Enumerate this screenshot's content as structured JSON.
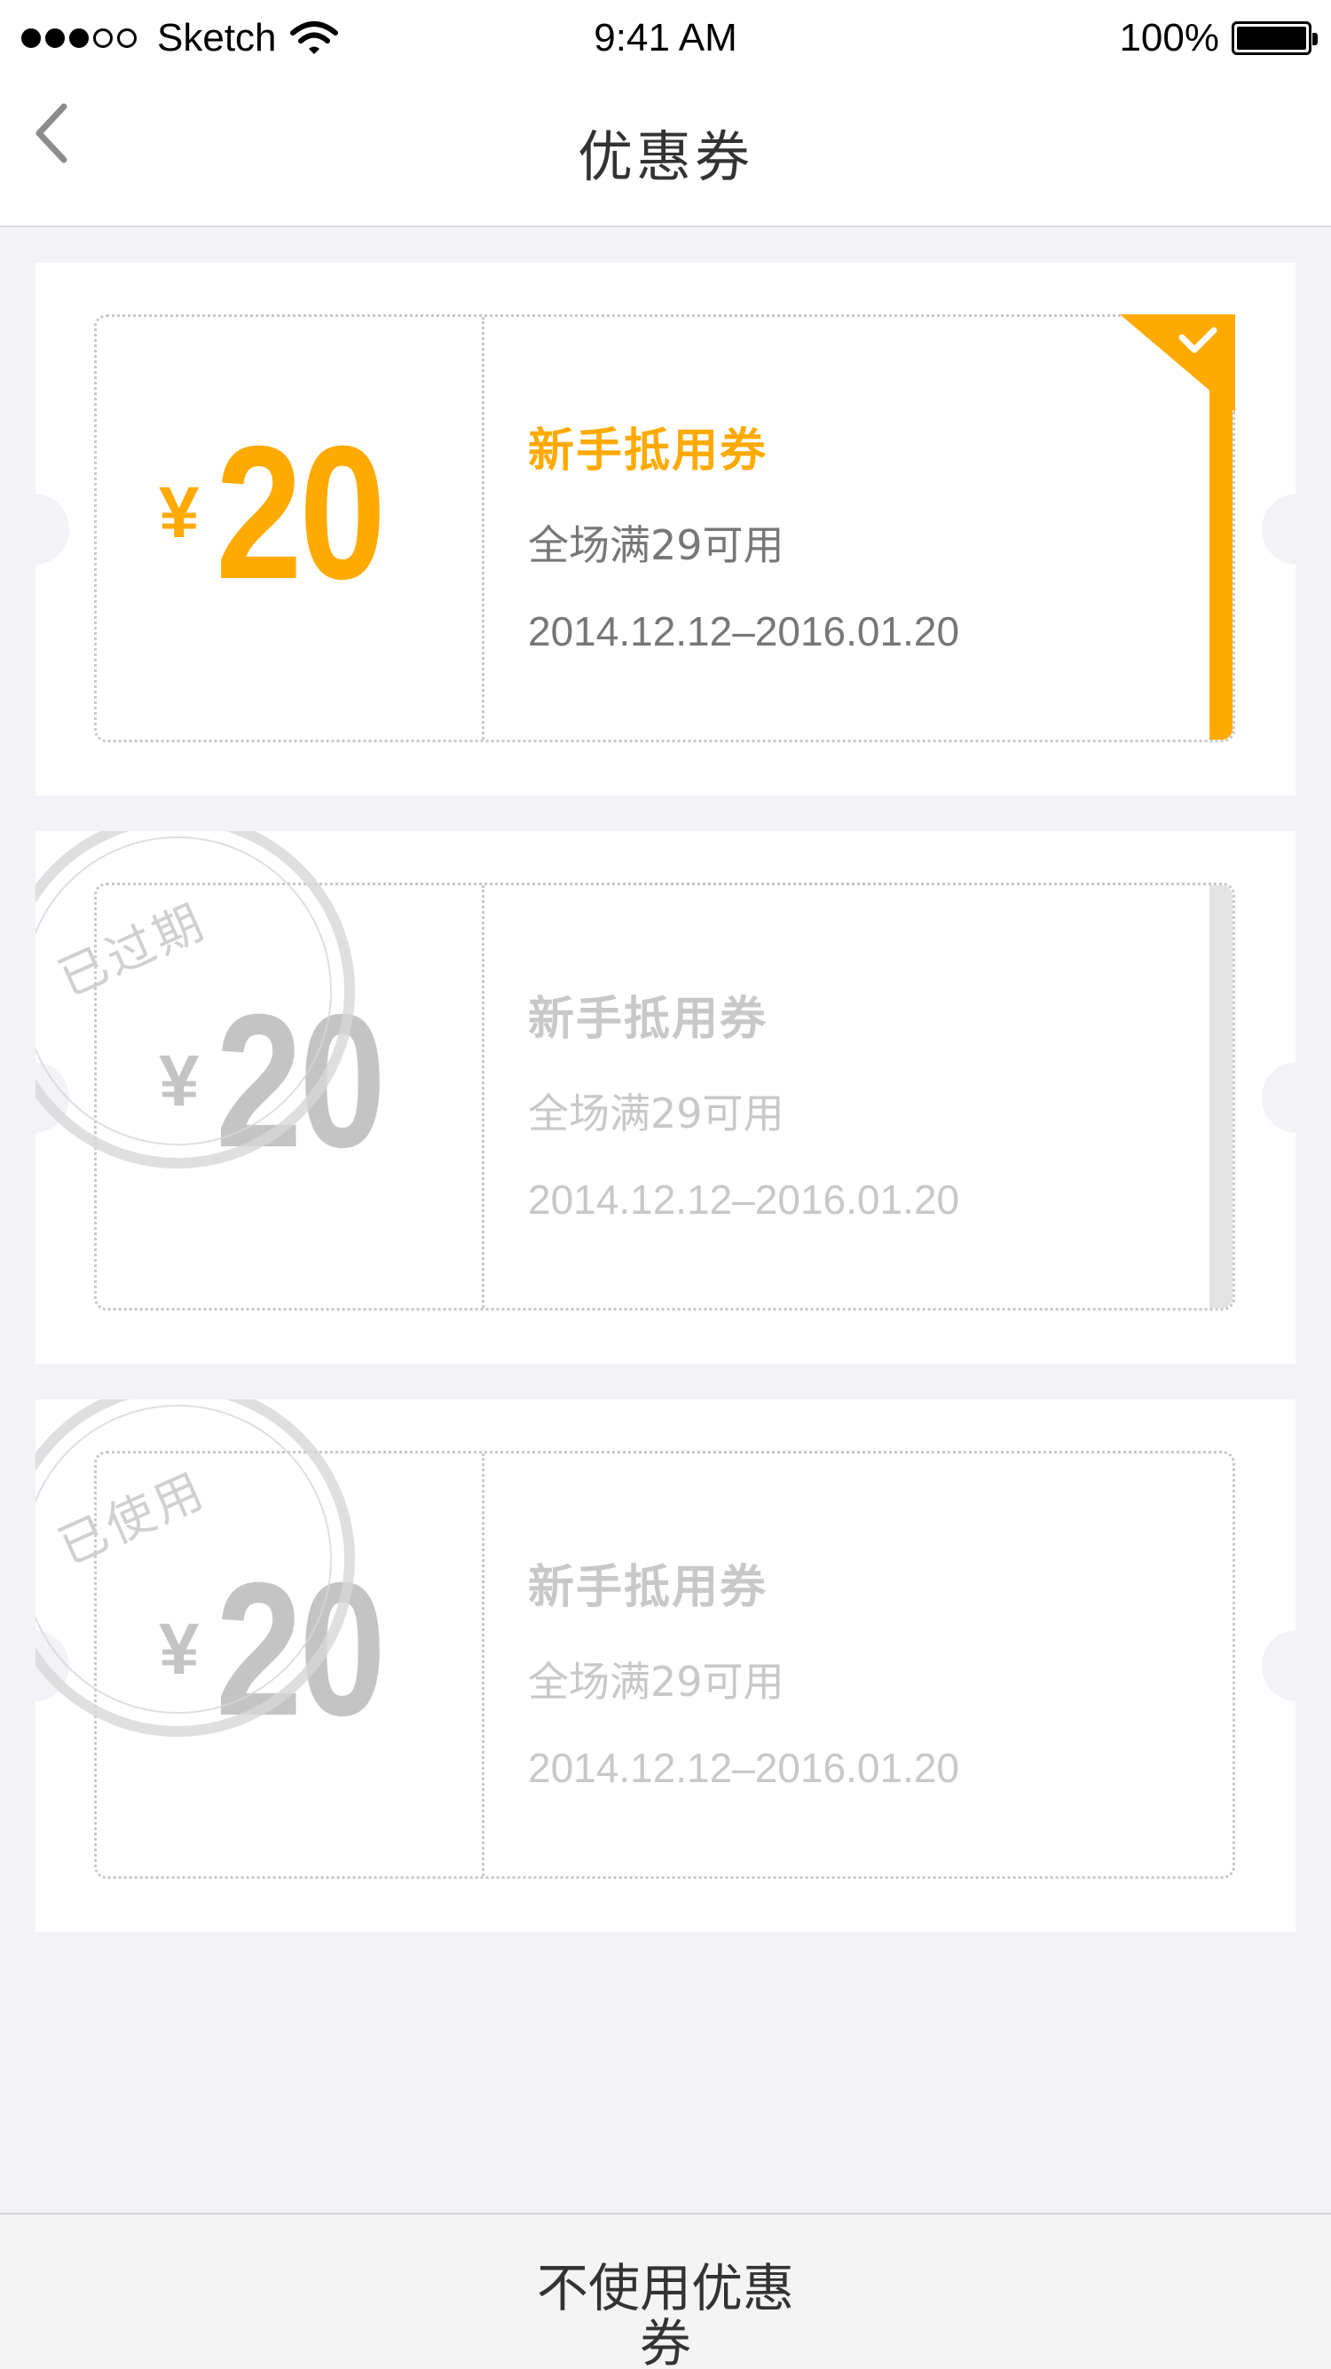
{
  "status_bar": {
    "carrier": "Sketch",
    "time": "9:41 AM",
    "battery": "100%",
    "battery_level": 1.0,
    "signal_bars_filled": 3,
    "signal_bars_total": 5
  },
  "nav": {
    "title": "优惠券",
    "back_icon": "chevron-left-icon"
  },
  "coupons": [
    {
      "currency": "¥",
      "amount": "20",
      "name": "新手抵用券",
      "condition": "全场满29可用",
      "validity": "2014.12.12–2016.01.20",
      "state": "selected",
      "stamp": ""
    },
    {
      "currency": "¥",
      "amount": "20",
      "name": "新手抵用券",
      "condition": "全场满29可用",
      "validity": "2014.12.12–2016.01.20",
      "state": "expired",
      "stamp": "已过期"
    },
    {
      "currency": "¥",
      "amount": "20",
      "name": "新手抵用券",
      "condition": "全场满29可用",
      "validity": "2014.12.12–2016.01.20",
      "state": "used",
      "stamp": "已使用"
    }
  ],
  "bottom_button": {
    "label": "不使用优惠券"
  },
  "colors": {
    "accent": "#ffaa00",
    "background": "#f2f2f7",
    "inactive": "#c8c8c8"
  }
}
